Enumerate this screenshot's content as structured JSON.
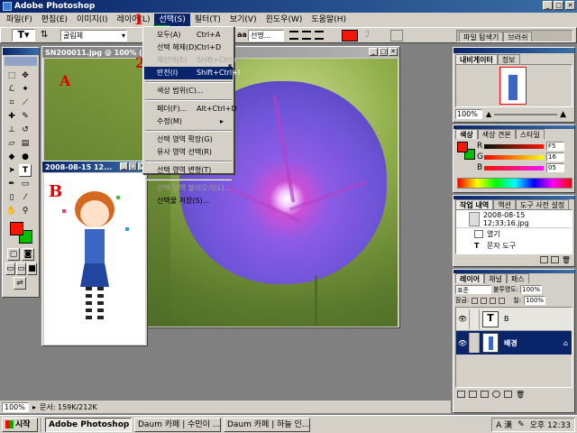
{
  "app": {
    "title": "Adobe Photoshop"
  },
  "menubar": {
    "items": [
      "파일(F)",
      "편집(E)",
      "이미지(I)",
      "레이어(L)",
      "선택(S)",
      "필터(T)",
      "보기(V)",
      "윈도우(W)",
      "도움말(H)"
    ]
  },
  "options_bar": {
    "font_family": "굴림체",
    "font_size_label": "선명...",
    "aa_label": "a"
  },
  "palette_well": {
    "tab1": "파일 탐색기",
    "tab2": "브러쉬"
  },
  "select_menu": {
    "items": [
      {
        "label": "모두(A)",
        "shortcut": "Ctrl+A"
      },
      {
        "label": "선택 해제(D)",
        "shortcut": "Ctrl+D"
      },
      {
        "label": "재선택(E)",
        "shortcut": "Shift+Ctrl+D",
        "disabled": true
      },
      {
        "label": "반전(I)",
        "shortcut": "Shift+Ctrl+I",
        "highlight": true
      }
    ],
    "group2": [
      {
        "label": "색상 범위(C)..."
      }
    ],
    "group3": [
      {
        "label": "페더(F)...",
        "shortcut": "Alt+Ctrl+D"
      },
      {
        "label": "수정(M)",
        "shortcut": "▸"
      }
    ],
    "group4": [
      {
        "label": "선택 영역 확장(G)"
      },
      {
        "label": "유사 영역 선택(R)"
      }
    ],
    "group5": [
      {
        "label": "선택 영역 변형(T)"
      }
    ],
    "group6": [
      {
        "label": "선택 영역 불러오기(L)...",
        "disabled": true
      },
      {
        "label": "선택물 저장(S)..."
      }
    ]
  },
  "doc_main": {
    "title": "SN200011.jpg @ 100% (RGB)"
  },
  "doc_small": {
    "title": "2008-08-15 12..."
  },
  "annotations": {
    "one": "1",
    "two": "2",
    "a": "A",
    "b": "B"
  },
  "navigator": {
    "tab1": "내비게이터",
    "tab2": "정보",
    "zoom": "100%"
  },
  "color_panel": {
    "tab1": "색상",
    "tab2": "색상 견본",
    "tab3": "스타일",
    "r_label": "R",
    "g_label": "G",
    "b_label": "B",
    "r_value": "F5",
    "g_value": "16",
    "b_value": "05",
    "fg_color": "#f51605",
    "bg_color": "#00c000"
  },
  "history_panel": {
    "tab1": "작업 내역",
    "tab2": "액션",
    "tab3": "도구 사전 설정",
    "snapshot": "2008-08-15 12;33;16.jpg",
    "items": [
      "열기",
      "문자 도구"
    ]
  },
  "layers_panel": {
    "tab1": "레이어",
    "tab2": "채널",
    "tab3": "패스",
    "blend_mode": "표준",
    "opacity_label": "불투명도:",
    "opacity": "100%",
    "lock_label": "잠금:",
    "fill_label": "칠:",
    "fill": "100%",
    "layers": [
      {
        "name": "B",
        "type": "text"
      },
      {
        "name": "배경",
        "type": "image",
        "selected": true
      }
    ]
  },
  "status_bar": {
    "zoom": "100%",
    "doc_info": "문서: 159K/212K"
  },
  "taskbar": {
    "start": "시작",
    "tasks": [
      "Adobe Photoshop",
      "Daum 카페 | 수민이 ...",
      "Daum 카페 | 하늘 인..."
    ],
    "tray_lang": "A 漢",
    "clock": "오후 12:33"
  },
  "colors": {
    "title_blue": "#0a246a",
    "flower_purple": "#7b5de0",
    "annotation_red": "#e00000"
  }
}
